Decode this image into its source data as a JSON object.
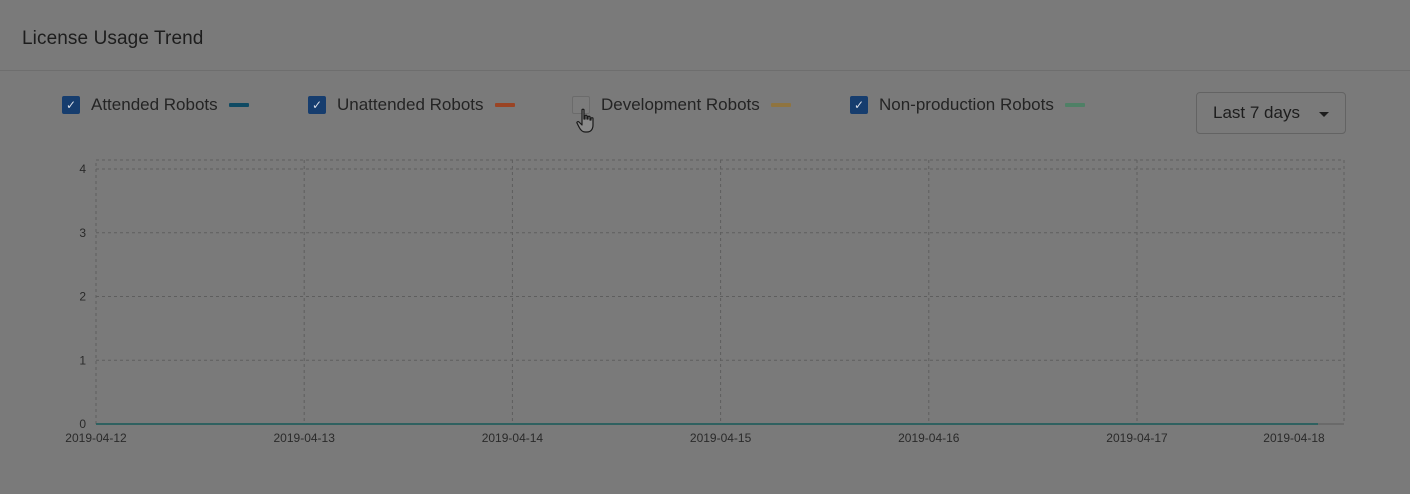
{
  "panel": {
    "title": "License Usage Trend"
  },
  "legend": [
    {
      "label": "Attended Robots",
      "checked": true,
      "color": "#0f4a63",
      "check_glyph": "✓"
    },
    {
      "label": "Unattended Robots",
      "checked": true,
      "color": "#9a4424",
      "check_glyph": "✓"
    },
    {
      "label": "Development Robots",
      "checked": false,
      "color": "#8f7440",
      "check_glyph": ""
    },
    {
      "label": "Non-production Robots",
      "checked": true,
      "color": "#4f8066",
      "check_glyph": "✓"
    }
  ],
  "range_select": {
    "value": "Last 7 days",
    "icon": "caret-down-icon"
  },
  "cursor": {
    "icon": "hand-pointer-icon"
  },
  "colors": {
    "overlay_background": "#7a7a7a",
    "grid": "#5e5e5e",
    "axis": "#5a5a5a",
    "line": "#2f6160"
  },
  "chart_data": {
    "type": "line",
    "x": [
      "2019-04-12",
      "2019-04-13",
      "2019-04-14",
      "2019-04-15",
      "2019-04-16",
      "2019-04-17",
      "2019-04-18"
    ],
    "y_ticks": [
      0,
      1,
      2,
      3,
      4
    ],
    "ylim": [
      0,
      4
    ],
    "grid": true,
    "series": [
      {
        "name": "Attended Robots",
        "values": [
          0,
          0,
          0,
          0,
          0,
          0,
          0
        ]
      },
      {
        "name": "Unattended Robots",
        "values": [
          0,
          0,
          0,
          0,
          0,
          0,
          0
        ]
      },
      {
        "name": "Non-production Robots",
        "values": [
          0,
          0,
          0,
          0,
          0,
          0,
          0
        ]
      }
    ]
  }
}
